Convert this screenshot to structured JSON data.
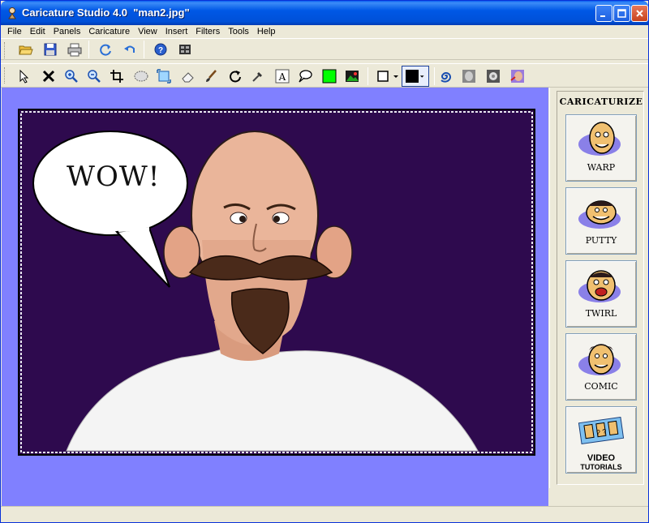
{
  "window": {
    "title": "Caricature Studio 4.0  \"man2.jpg\"",
    "accent": "#0058E6"
  },
  "menu": [
    {
      "label": "File"
    },
    {
      "label": "Edit"
    },
    {
      "label": "Panels"
    },
    {
      "label": "Caricature"
    },
    {
      "label": "View"
    },
    {
      "label": "Insert"
    },
    {
      "label": "Filters"
    },
    {
      "label": "Tools"
    },
    {
      "label": "Help"
    }
  ],
  "toolbar_main": [
    "open-folder-icon",
    "save-icon",
    "print-icon",
    "refresh-icon",
    "undo-icon",
    "help-icon",
    "filmstrip-icon"
  ],
  "toolbar_tools": [
    "pointer-icon",
    "delete-icon",
    "zoom-in-icon",
    "zoom-out-icon",
    "crop-icon",
    "ellipse-select-icon",
    "fit-icon",
    "eraser-icon",
    "brush-icon",
    "rotate-icon",
    "eyedropper-icon",
    "text-icon",
    "speech-bubble-icon",
    "green-color-swatch",
    "image-icon",
    "shape-outline-dropdown",
    "fill-color-dropdown",
    "swirl-icon",
    "face-gray-icon",
    "face-morph-icon",
    "face-warp-icon"
  ],
  "colors": {
    "workspace": "#8080FF",
    "canvas_background": "#2E0A4E",
    "swatch_green": "#00FF00",
    "fill_color": "#000000"
  },
  "canvas": {
    "bubble_text": "WOW!"
  },
  "panel": {
    "title": "CARICATURIZE",
    "buttons": [
      {
        "label": "WARP"
      },
      {
        "label": "PUTTY"
      },
      {
        "label": "TWIRL"
      },
      {
        "label": "COMIC"
      },
      {
        "label": "VIDEO",
        "sublabel": "TUTORIALS"
      }
    ]
  }
}
